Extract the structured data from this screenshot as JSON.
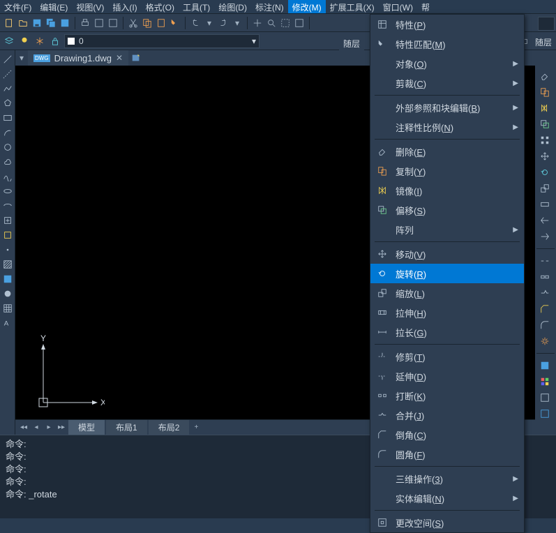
{
  "menubar": [
    {
      "label": "文件(F)",
      "hot": "F"
    },
    {
      "label": "编辑(E)",
      "hot": "E"
    },
    {
      "label": "视图(V)",
      "hot": "V"
    },
    {
      "label": "插入(I)",
      "hot": "I"
    },
    {
      "label": "格式(O)",
      "hot": "O"
    },
    {
      "label": "工具(T)",
      "hot": "T"
    },
    {
      "label": "绘图(D)",
      "hot": "D"
    },
    {
      "label": "标注(N)",
      "hot": "N"
    },
    {
      "label": "修改(M)",
      "hot": "M",
      "active": true
    },
    {
      "label": "扩展工具(X)",
      "hot": "X"
    },
    {
      "label": "窗口(W)",
      "hot": "W"
    },
    {
      "label": "帮",
      "hot": ""
    }
  ],
  "layer_combo_value": "0",
  "tab": {
    "filename": "Drawing1.dwg"
  },
  "panel_label_left": "随层",
  "panel_label_right": "随层",
  "layout_tabs": {
    "active": "模型",
    "others": [
      "布局1",
      "布局2"
    ]
  },
  "cmd_prompt": "命令:",
  "cmd_last": "_rotate",
  "dropdown": {
    "groups": [
      [
        {
          "label": "特性",
          "hot": "P",
          "icon": "props"
        },
        {
          "label": "特性匹配",
          "hot": "M",
          "icon": "match"
        },
        {
          "label": "对象",
          "hot": "O",
          "sub": true
        },
        {
          "label": "剪裁",
          "hot": "C",
          "sub": true
        }
      ],
      [
        {
          "label": "外部参照和块编辑",
          "hot": "B",
          "sub": true
        },
        {
          "label": "注释性比例",
          "hot": "N",
          "sub": true
        }
      ],
      [
        {
          "label": "删除",
          "hot": "E",
          "icon": "erase"
        },
        {
          "label": "复制",
          "hot": "Y",
          "icon": "copy"
        },
        {
          "label": "镜像",
          "hot": "I",
          "icon": "mirror"
        },
        {
          "label": "偏移",
          "hot": "S",
          "icon": "offset"
        },
        {
          "label": "阵列",
          "sub": true
        }
      ],
      [
        {
          "label": "移动",
          "hot": "V",
          "icon": "move"
        },
        {
          "label": "旋转",
          "hot": "R",
          "icon": "rotate",
          "highlight": true
        },
        {
          "label": "缩放",
          "hot": "L",
          "icon": "scale"
        },
        {
          "label": "拉伸",
          "hot": "H",
          "icon": "stretch"
        },
        {
          "label": "拉长",
          "hot": "G",
          "icon": "lengthen"
        }
      ],
      [
        {
          "label": "修剪",
          "hot": "T",
          "icon": "trim"
        },
        {
          "label": "延伸",
          "hot": "D",
          "icon": "extend"
        },
        {
          "label": "打断",
          "hot": "K",
          "icon": "break"
        },
        {
          "label": "合并",
          "hot": "J",
          "icon": "join"
        },
        {
          "label": "倒角",
          "hot": "C",
          "icon": "chamfer"
        },
        {
          "label": "圆角",
          "hot": "F",
          "icon": "fillet"
        }
      ],
      [
        {
          "label": "三维操作",
          "hot": "3",
          "sub": true
        },
        {
          "label": "实体编辑",
          "hot": "N",
          "sub": true
        }
      ],
      [
        {
          "label": "更改空间",
          "hot": "S",
          "icon": "chspace"
        }
      ]
    ]
  },
  "ucs": {
    "x_label": "X",
    "y_label": "Y"
  }
}
